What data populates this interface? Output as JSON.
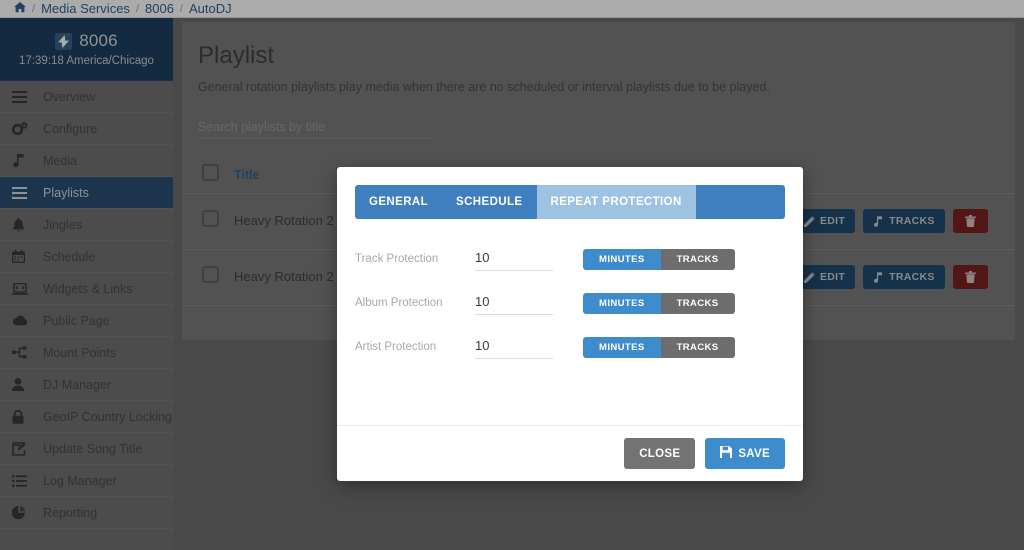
{
  "breadcrumb": {
    "home_icon": "home-icon",
    "items": [
      "Media Services",
      "8006",
      "AutoDJ"
    ],
    "separator": "/"
  },
  "sidebar": {
    "station": {
      "icon": "bolt-icon",
      "name": "8006",
      "clock": "17:39:18 America/Chicago"
    },
    "items": [
      {
        "label": "Overview",
        "icon": "bars-icon",
        "active": false
      },
      {
        "label": "Configure",
        "icon": "gears-icon",
        "active": false
      },
      {
        "label": "Media",
        "icon": "music-note-icon",
        "active": false
      },
      {
        "label": "Playlists",
        "icon": "list-ul-icon",
        "active": true
      },
      {
        "label": "Jingles",
        "icon": "bell-icon",
        "active": false
      },
      {
        "label": "Schedule",
        "icon": "calendar-icon",
        "active": false
      },
      {
        "label": "Widgets & Links",
        "icon": "laptop-code-icon",
        "active": false
      },
      {
        "label": "Public Page",
        "icon": "cloud-icon",
        "active": false
      },
      {
        "label": "Mount Points",
        "icon": "sitemap-icon",
        "active": false
      },
      {
        "label": "DJ Manager",
        "icon": "user-icon",
        "active": false
      },
      {
        "label": "GeoIP Country Locking",
        "icon": "lock-icon",
        "active": false
      },
      {
        "label": "Update Song Title",
        "icon": "edit-square-icon",
        "active": false
      },
      {
        "label": "Log Manager",
        "icon": "list-icon",
        "active": false
      },
      {
        "label": "Reporting",
        "icon": "pie-chart-icon",
        "active": false
      }
    ]
  },
  "page": {
    "title": "Playlist",
    "description": "General rotation playlists play media when there are no scheduled or interval playlists due to be played.",
    "search_placeholder": "Search playlists by title",
    "search_value": ""
  },
  "table": {
    "columns": [
      "Title"
    ],
    "rows": [
      {
        "title": "Heavy Rotation 2",
        "actions": [
          {
            "label": "EDIT",
            "icon": "pencil-icon",
            "style": "edit"
          },
          {
            "label": "TRACKS",
            "icon": "music-note-icon",
            "style": "tracks"
          },
          {
            "label": "",
            "icon": "trash-icon",
            "style": "delete"
          }
        ]
      },
      {
        "title": "Heavy Rotation 2",
        "actions": [
          {
            "label": "EDIT",
            "icon": "pencil-icon",
            "style": "edit"
          },
          {
            "label": "TRACKS",
            "icon": "music-note-icon",
            "style": "tracks"
          },
          {
            "label": "",
            "icon": "trash-icon",
            "style": "delete"
          }
        ]
      }
    ]
  },
  "modal": {
    "tabs": [
      {
        "label": "GENERAL",
        "active": false
      },
      {
        "label": "SCHEDULE",
        "active": false
      },
      {
        "label": "REPEAT PROTECTION",
        "active": true
      }
    ],
    "fields": [
      {
        "label": "Track Protection",
        "value": "10",
        "unit_options": [
          "MINUTES",
          "TRACKS"
        ],
        "unit_selected": "MINUTES"
      },
      {
        "label": "Album Protection",
        "value": "10",
        "unit_options": [
          "MINUTES",
          "TRACKS"
        ],
        "unit_selected": "MINUTES"
      },
      {
        "label": "Artist Protection",
        "value": "10",
        "unit_options": [
          "MINUTES",
          "TRACKS"
        ],
        "unit_selected": "MINUTES"
      }
    ],
    "footer": {
      "close_label": "CLOSE",
      "save_label": "SAVE",
      "save_icon": "save-floppy-icon"
    }
  },
  "colors": {
    "accent_blue": "#3f8ccd",
    "tab_bar_blue": "#3f7fbf",
    "tab_active_blue": "#9dc2e2",
    "sidebar_header": "#1d3f61",
    "sidebar_active": "#2b4f73",
    "danger_red": "#7c2222",
    "dark_blue_button": "#22496f",
    "grey_button": "#737373"
  }
}
